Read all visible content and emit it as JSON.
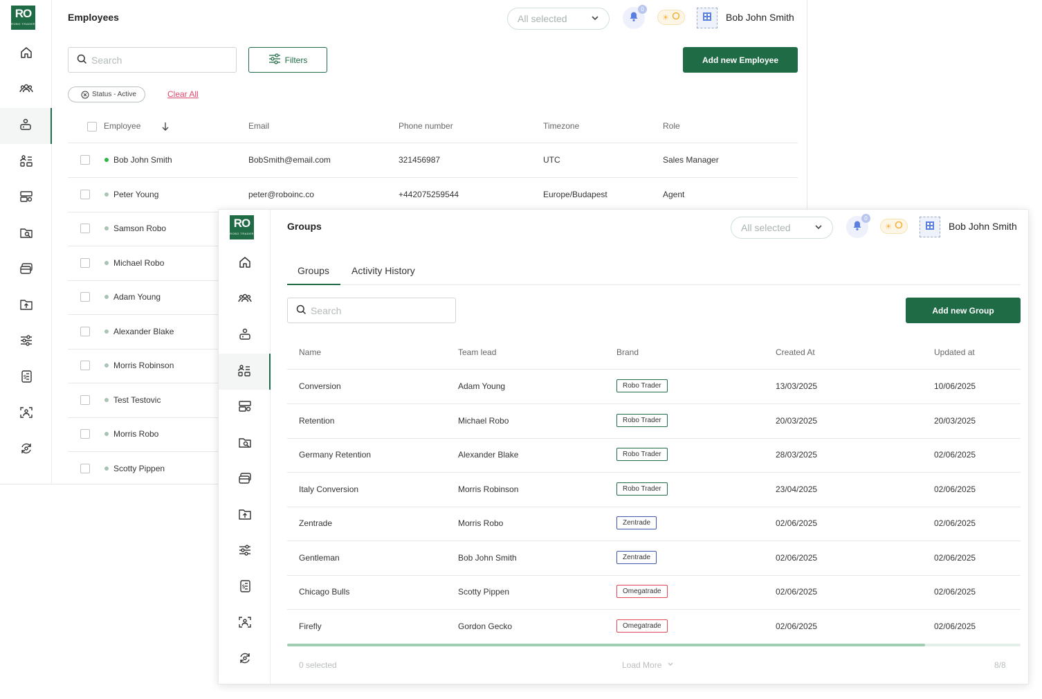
{
  "employees": {
    "title": "Employees",
    "top": {
      "select_value": "All selected",
      "notification_count": "0",
      "user_name": "Bob John Smith"
    },
    "search_placeholder": "Search",
    "filters_label": "Filters",
    "add_button": "Add new Employee",
    "filter_chip": "Status - Active",
    "clear_all": "Clear All",
    "columns": [
      "Employee",
      "Email",
      "Phone number",
      "Timezone",
      "Role"
    ],
    "rows": [
      {
        "name": "Bob John Smith",
        "email": "BobSmith@email.com",
        "phone": "321456987",
        "timezone": "UTC",
        "role": "Sales Manager",
        "online": true
      },
      {
        "name": "Peter Young",
        "email": "peter@roboinc.co",
        "phone": "+442075259544",
        "timezone": "Europe/Budapest",
        "role": "Agent",
        "online": false
      },
      {
        "name": "Samson Robo",
        "online": false
      },
      {
        "name": "Michael Robo",
        "online": false
      },
      {
        "name": "Adam Young",
        "online": false
      },
      {
        "name": "Alexander Blake",
        "online": false
      },
      {
        "name": "Morris Robinson",
        "online": false
      },
      {
        "name": "Test Testovic",
        "online": false
      },
      {
        "name": "Morris Robo",
        "online": false
      },
      {
        "name": "Scotty Pippen",
        "online": false
      }
    ]
  },
  "groups": {
    "title": "Groups",
    "top": {
      "select_value": "All selected",
      "notification_count": "0",
      "user_name": "Bob John Smith"
    },
    "tabs": [
      "Groups",
      "Activity History"
    ],
    "search_placeholder": "Search",
    "add_button": "Add new Group",
    "columns": [
      "Name",
      "Team lead",
      "Brand",
      "Created At",
      "Updated at"
    ],
    "rows": [
      {
        "name": "Conversion",
        "lead": "Adam Young",
        "brand": "Robo Trader",
        "created": "13/03/2025",
        "updated": "10/06/2025"
      },
      {
        "name": "Retention",
        "lead": "Michael Robo",
        "brand": "Robo Trader",
        "created": "20/03/2025",
        "updated": "20/03/2025"
      },
      {
        "name": "Germany Retention",
        "lead": "Alexander Blake",
        "brand": "Robo Trader",
        "created": "28/03/2025",
        "updated": "02/06/2025"
      },
      {
        "name": "Italy Conversion",
        "lead": "Morris Robinson",
        "brand": "Robo Trader",
        "created": "23/04/2025",
        "updated": "02/06/2025"
      },
      {
        "name": "Zentrade",
        "lead": "Morris Robo",
        "brand": "Zentrade",
        "created": "02/06/2025",
        "updated": "02/06/2025"
      },
      {
        "name": "Gentleman",
        "lead": "Bob John Smith",
        "brand": "Zentrade",
        "created": "02/06/2025",
        "updated": "02/06/2025"
      },
      {
        "name": "Chicago Bulls",
        "lead": "Scotty Pippen",
        "brand": "Omegatrade",
        "created": "02/06/2025",
        "updated": "02/06/2025"
      },
      {
        "name": "Firefly",
        "lead": "Gordon Gecko",
        "brand": "Omegatrade",
        "created": "02/06/2025",
        "updated": "02/06/2025"
      }
    ],
    "footer": {
      "selected": "0 selected",
      "load_more": "Load More",
      "count": "8/8"
    },
    "scroll_fraction": 0.87
  },
  "brand_colors": {
    "Robo Trader": "#1f6b45",
    "Zentrade": "#3f56b5",
    "Omegatrade": "#e0485a"
  },
  "colors": {
    "accent": "#1f6b45",
    "online": "#2fb344",
    "offline": "#a9c4b3"
  },
  "logo": {
    "line1": "RO",
    "line2": "ROBO TRADER"
  },
  "nav_icons": [
    "home-icon",
    "users-icon",
    "employee-icon",
    "groups-icon",
    "desks-icon",
    "lead-search-icon",
    "cards-icon",
    "upload-folder-icon",
    "settings-sliders-icon",
    "reports-icon",
    "scan-icon",
    "sync-icon"
  ]
}
